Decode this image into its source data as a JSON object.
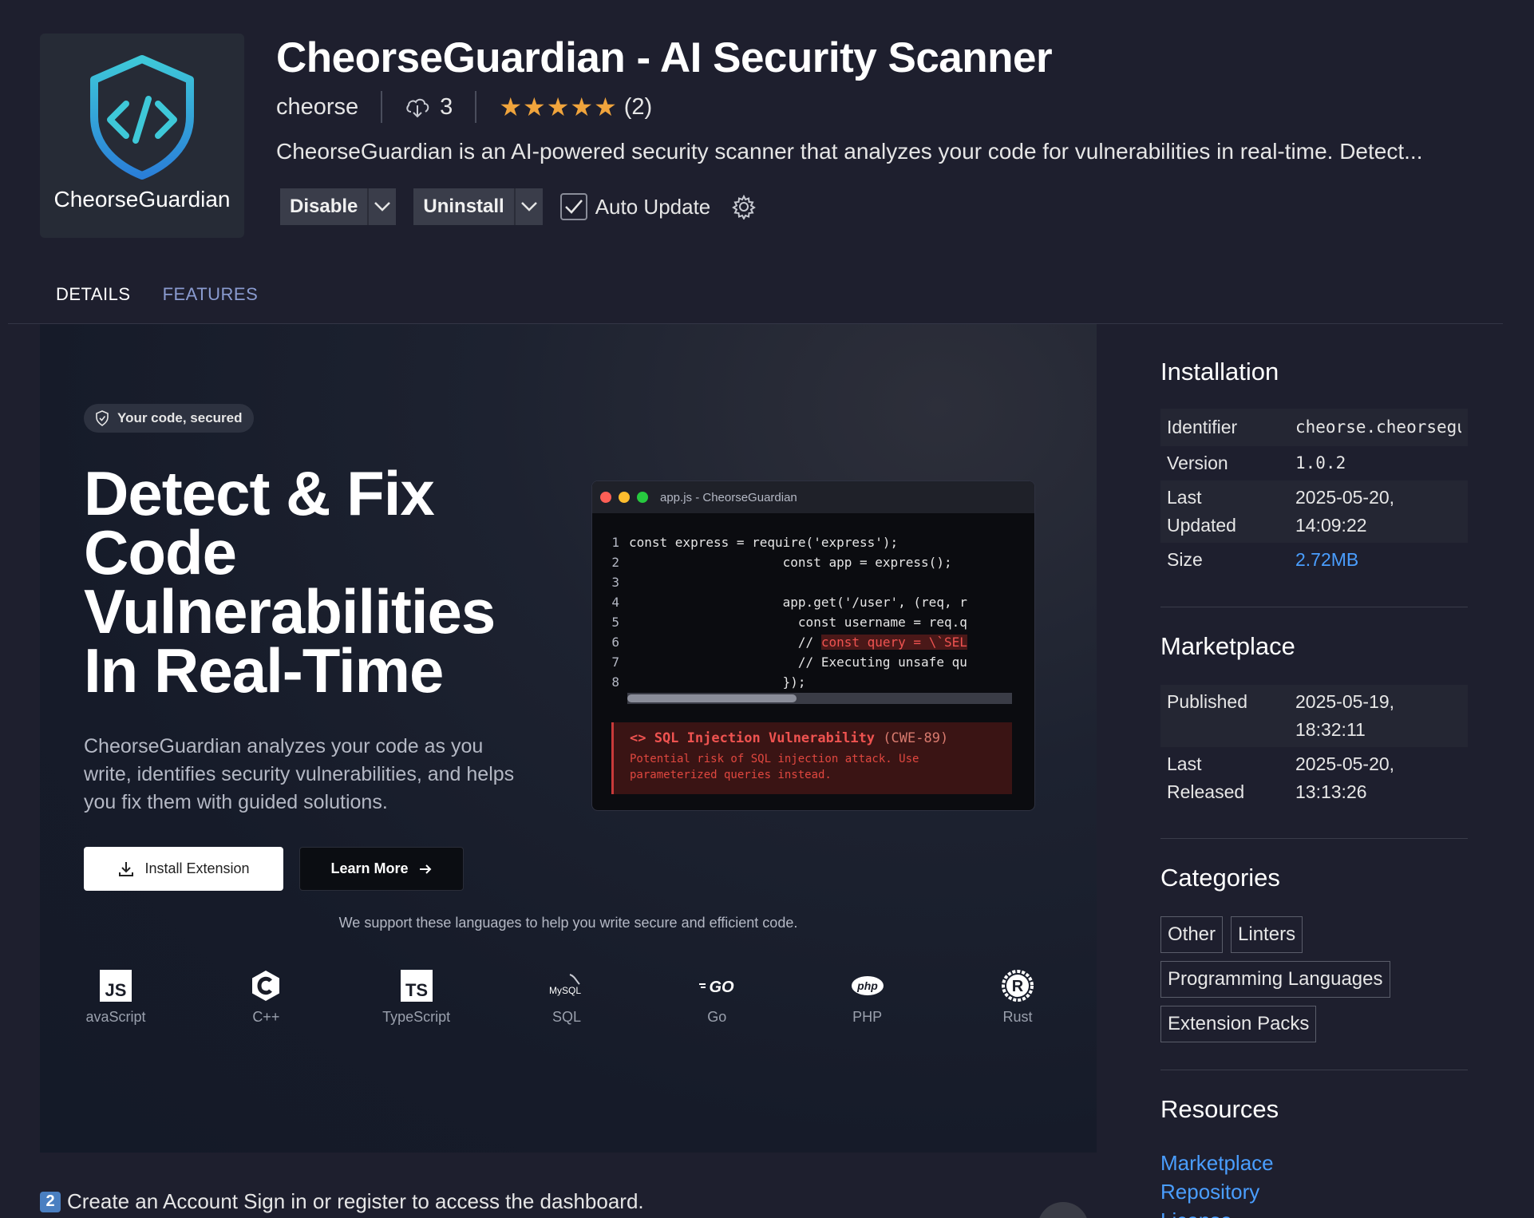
{
  "extension": {
    "logo_label": "CheorseGuardian",
    "title": "CheorseGuardian - AI Security Scanner",
    "publisher": "cheorse",
    "installs": "3",
    "stars": "★★★★★",
    "rating_count": "(2)",
    "rating": 5,
    "description": "CheorseGuardian is an AI-powered security scanner that analyzes your code for vulnerabilities in real-time. Detect..."
  },
  "actions": {
    "disable_label": "Disable",
    "uninstall_label": "Uninstall",
    "auto_update_label": "Auto Update",
    "auto_update_checked": true
  },
  "tabs": [
    {
      "label": "DETAILS",
      "active": true
    },
    {
      "label": "FEATURES",
      "active": false
    }
  ],
  "hero": {
    "pill_label": "Your code, secured",
    "headline": [
      "Detect & Fix",
      "Code",
      "Vulnerabilities",
      "In Real-Time"
    ],
    "description": "CheorseGuardian analyzes your code as you write, identifies security vulnerabilities, and helps you fix them with guided solutions.",
    "install_label": "Install Extension",
    "learn_label": "Learn More",
    "support_text": "We support these languages to help you write secure and efficient code.",
    "languages": [
      {
        "name": "avaScript",
        "icon": "javascript-icon"
      },
      {
        "name": "C++",
        "icon": "cpp-icon"
      },
      {
        "name": "TypeScript",
        "icon": "typescript-icon"
      },
      {
        "name": "SQL",
        "icon": "mysql-icon"
      },
      {
        "name": "Go",
        "icon": "go-icon"
      },
      {
        "name": "PHP",
        "icon": "php-icon"
      },
      {
        "name": "Rust",
        "icon": "rust-icon"
      }
    ]
  },
  "code_window": {
    "title": "app.js - CheorseGuardian",
    "line_numbers": [
      "1",
      "2",
      "3",
      "4",
      "5",
      "6",
      "7",
      "8"
    ],
    "lines": [
      "const express = require('express');",
      "                    const app = express();",
      "",
      "                    app.get('/user', (req, r",
      "                      const username = req.q",
      "                      // ",
      "                      // Executing unsafe qu",
      "                    });"
    ],
    "vuln_snippet": "const query = \\`SEL",
    "alert_title": "<> SQL Injection Vulnerability",
    "alert_cwe": "(CWE-89)",
    "alert_line1": "Potential risk of SQL injection attack. Use",
    "alert_line2": "parameterized queries instead."
  },
  "step": {
    "number": "2",
    "text": "Create an Account Sign in or register to access the dashboard."
  },
  "sidebar": {
    "installation": {
      "heading": "Installation",
      "identifier_key": "Identifier",
      "identifier": "cheorse.cheorseguardi",
      "version_key": "Version",
      "version": "1.0.2",
      "last_updated_key": [
        "Last",
        "Updated"
      ],
      "last_updated": [
        "2025-05-20,",
        "14:09:22"
      ],
      "size_key": "Size",
      "size": "2.72MB"
    },
    "marketplace": {
      "heading": "Marketplace",
      "published_key": "Published",
      "published": [
        "2025-05-19,",
        "18:32:11"
      ],
      "last_released_key": [
        "Last",
        "Released"
      ],
      "last_released": [
        "2025-05-20,",
        "13:13:26"
      ]
    },
    "categories": {
      "heading": "Categories",
      "items": [
        "Other",
        "Linters",
        "Programming Languages",
        "Extension Packs"
      ]
    },
    "resources": {
      "heading": "Resources",
      "links": [
        "Marketplace",
        "Repository",
        "License"
      ]
    }
  },
  "colors": {
    "background": "#1e1f2e",
    "accent_link": "#4a9eff",
    "star": "#f0a43c",
    "vuln_red": "#ef5350"
  }
}
